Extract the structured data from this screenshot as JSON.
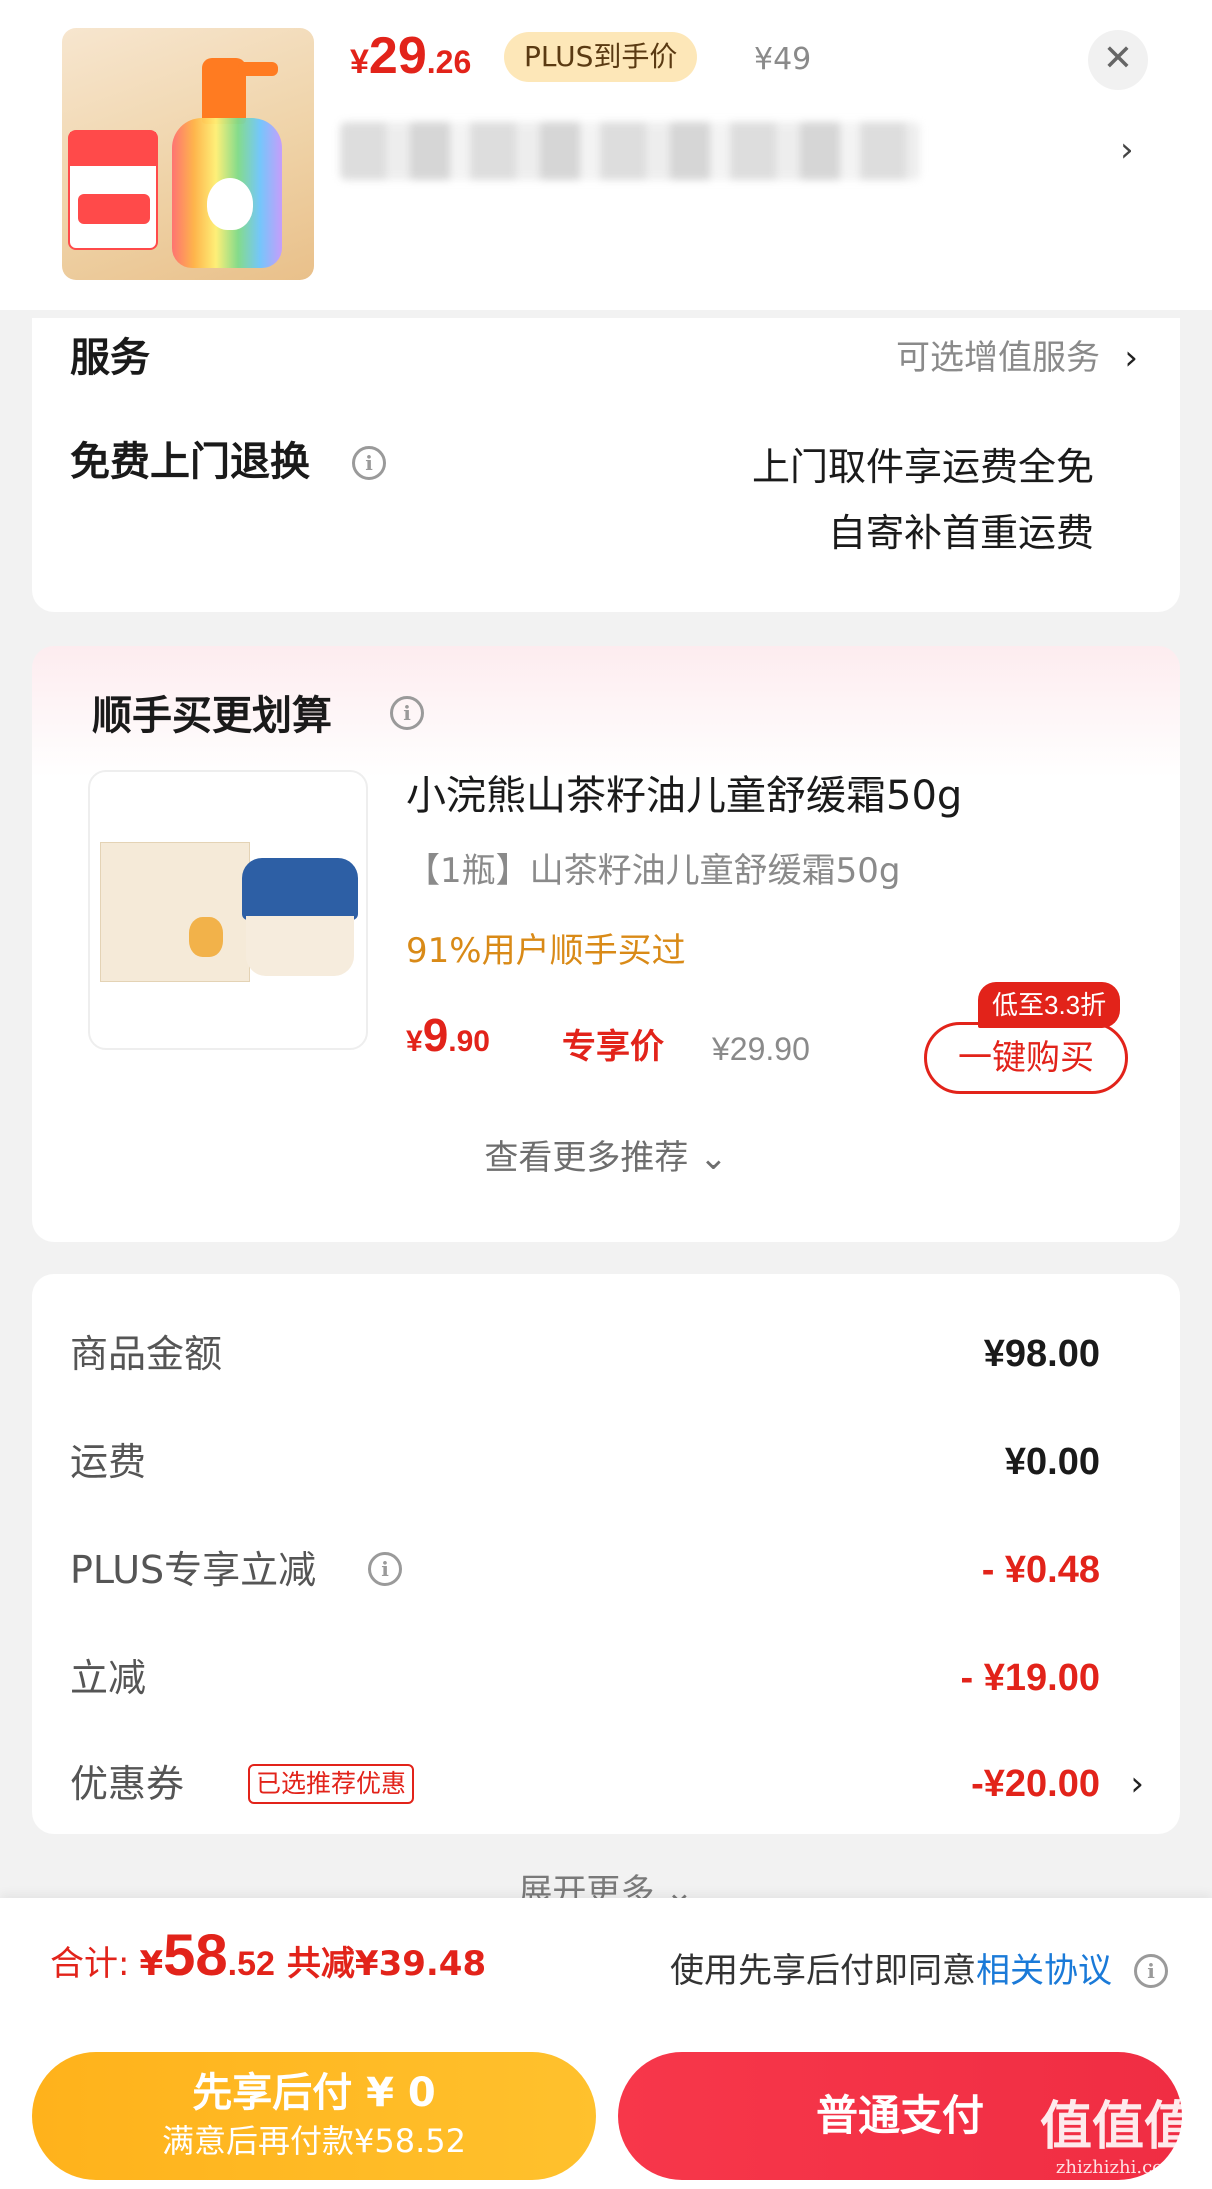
{
  "product": {
    "price_symbol": "¥",
    "price_int": "29",
    "price_dec": ".26",
    "plus_tag": "PLUS到手价",
    "original_price": "¥49",
    "close_icon": "close-icon",
    "chevron_icon": "chevron-right-icon"
  },
  "service": {
    "title": "服务",
    "optional_label": "可选增值服务",
    "return_title": "免费上门退换",
    "return_desc_line1": "上门取件享运费全免",
    "return_desc_line2": "自寄补首重运费"
  },
  "recommend": {
    "title": "顺手买更划算",
    "item": {
      "name": "小浣熊山茶籽油儿童舒缓霜50g",
      "spec": "【1瓶】山茶籽油儿童舒缓霜50g",
      "stat": "91%用户顺手买过",
      "price_symbol": "¥",
      "price_int": "9",
      "price_dec": ".90",
      "exclusive_label": "专享价",
      "original_price": "¥29.90",
      "discount_tag": "低至3.3折",
      "buy_label": "一键购买"
    },
    "more_label": "查看更多推荐 ⌄"
  },
  "summary": {
    "rows": [
      {
        "label": "商品金额",
        "value": "¥98.00"
      },
      {
        "label": "运费",
        "value": "¥0.00"
      },
      {
        "label": "PLUS专享立减",
        "value": "- ¥0.48"
      },
      {
        "label": "立减",
        "value": "- ¥19.00"
      },
      {
        "label": "优惠券",
        "value": "-¥20.00",
        "tag": "已选推荐优惠"
      }
    ],
    "expand_label": "展开更多 ⌄"
  },
  "bottom": {
    "total_label": "合计:",
    "total_symbol": "¥",
    "total_int": "58",
    "total_dec": ".52",
    "saved": "共减¥39.48",
    "agree_text": "使用先享后付即同意",
    "agree_link": "相关协议",
    "later_line1": "先享后付 ¥ 0",
    "later_line2": "满意后再付款¥58.52",
    "pay_label": "普通支付",
    "watermark_big": "值值值",
    "watermark_small": "zhizhizhi.com"
  },
  "colors": {
    "accent_red": "#e2231a",
    "plus_gold": "#fde7b8",
    "later_orange": "#ffb21b",
    "link_blue": "#1a7ad8"
  }
}
